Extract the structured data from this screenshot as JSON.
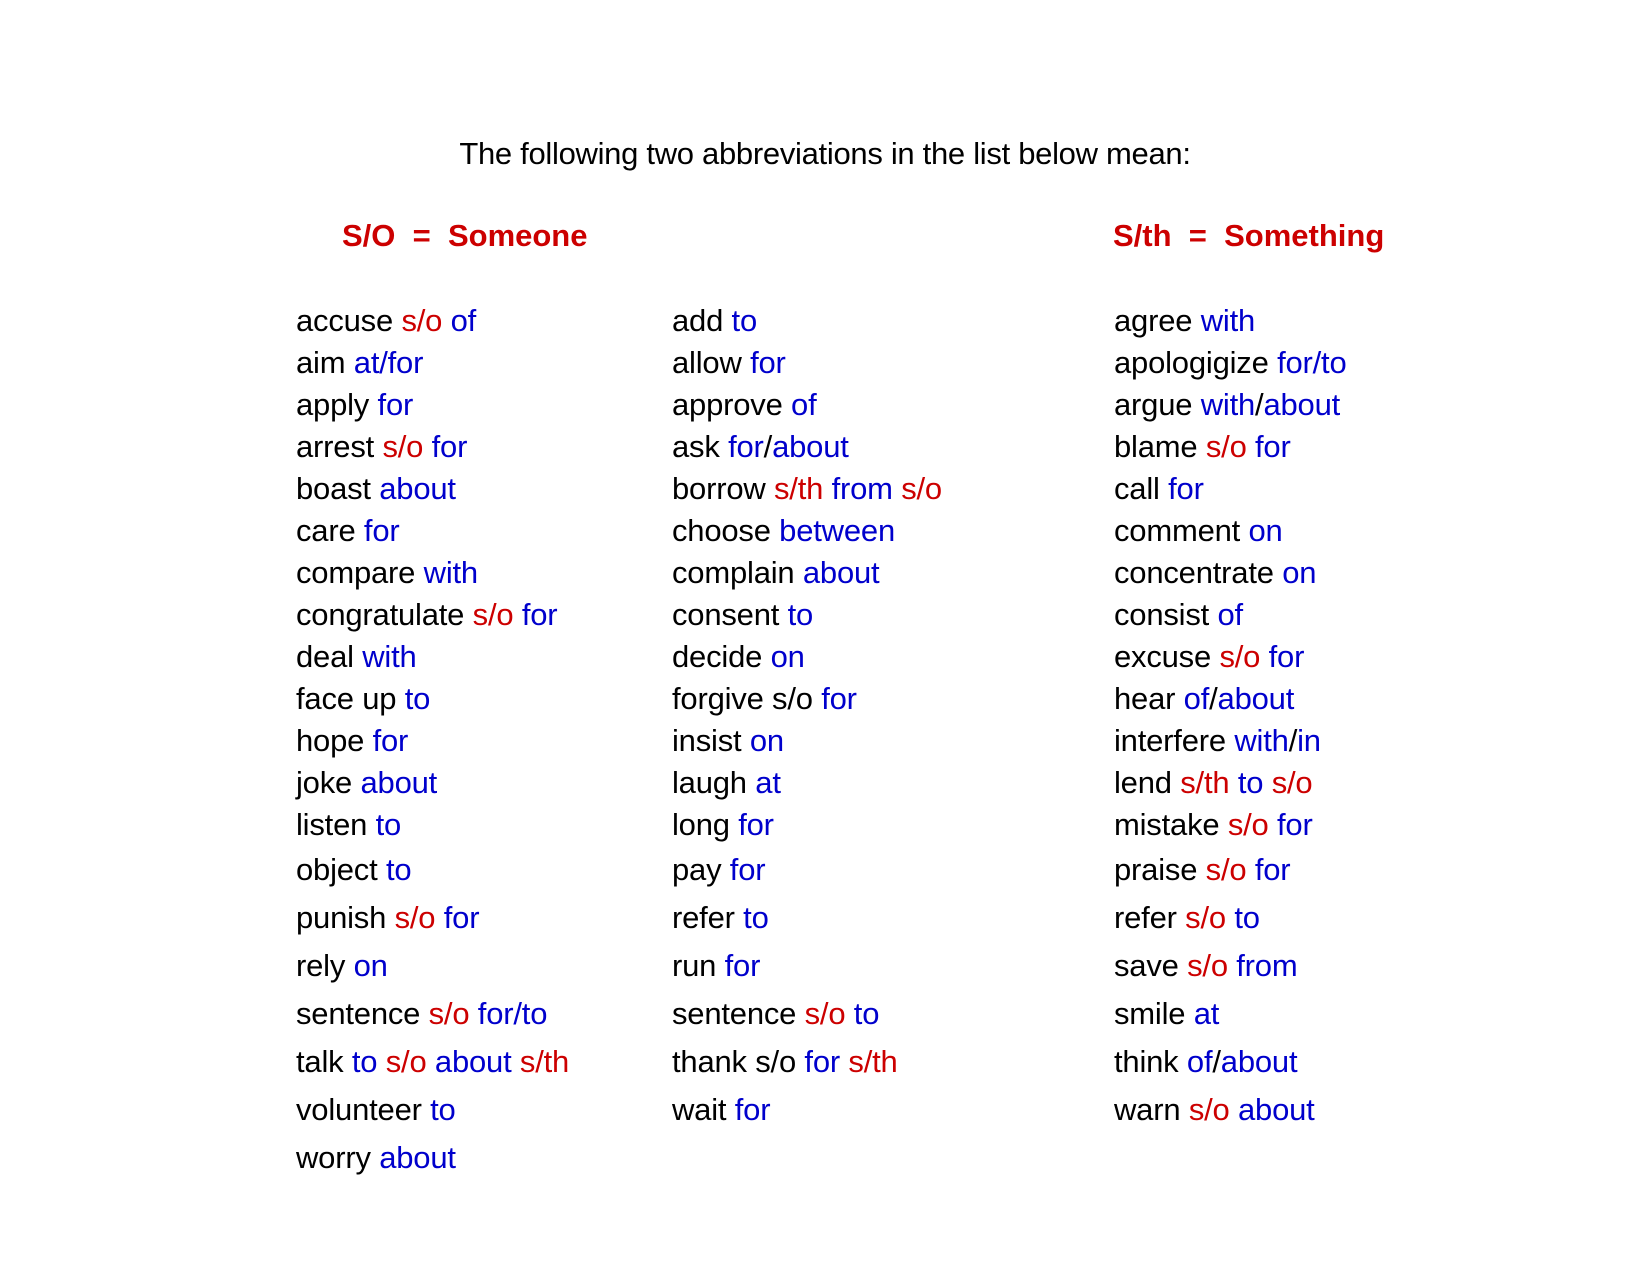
{
  "intro": "The following two abbreviations in the list below mean:",
  "legend": {
    "someone": "S/O  =  Someone",
    "something": "S/th  =  Something"
  },
  "colors": {
    "verb": "#000000",
    "placeholder": "#cc0000",
    "preposition": "#0000cc"
  },
  "columns": [
    [
      [
        [
          "accuse",
          "k"
        ],
        [
          " s/o",
          "r"
        ],
        [
          " of",
          "b"
        ]
      ],
      [
        [
          "aim",
          "k"
        ],
        [
          " at/for",
          "b"
        ]
      ],
      [
        [
          "apply",
          "k"
        ],
        [
          " for",
          "b"
        ]
      ],
      [
        [
          "arrest",
          "k"
        ],
        [
          " s/o",
          "r"
        ],
        [
          " for",
          "b"
        ]
      ],
      [
        [
          "boast",
          "k"
        ],
        [
          " about",
          "b"
        ]
      ],
      [
        [
          "care",
          "k"
        ],
        [
          " for",
          "b"
        ]
      ],
      [
        [
          "compare",
          "k"
        ],
        [
          " with",
          "b"
        ]
      ],
      [
        [
          "congratulate",
          "k"
        ],
        [
          " s/o",
          "r"
        ],
        [
          " for",
          "b"
        ]
      ],
      [
        [
          "deal",
          "k"
        ],
        [
          " with",
          "b"
        ]
      ],
      [
        [
          "face up",
          "k"
        ],
        [
          " to",
          "b"
        ]
      ],
      [
        [
          "hope",
          "k"
        ],
        [
          " for",
          "b"
        ]
      ],
      [
        [
          "joke",
          "k"
        ],
        [
          " about",
          "b"
        ]
      ],
      [
        [
          "listen",
          "k"
        ],
        [
          " to",
          "b"
        ]
      ],
      [
        [
          "object",
          "k"
        ],
        [
          " to",
          "b"
        ]
      ],
      [
        [
          "punish",
          "k"
        ],
        [
          " s/o",
          "r"
        ],
        [
          " for",
          "b"
        ]
      ],
      [
        [
          "rely",
          "k"
        ],
        [
          " on",
          "b"
        ]
      ],
      [
        [
          "sentence",
          "k"
        ],
        [
          " s/o",
          "r"
        ],
        [
          " for/to",
          "b"
        ]
      ],
      [
        [
          "talk",
          "k"
        ],
        [
          " to",
          "b"
        ],
        [
          " s/o",
          "r"
        ],
        [
          " about",
          "b"
        ],
        [
          " s/th",
          "r"
        ]
      ],
      [
        [
          "volunteer",
          "k"
        ],
        [
          " to",
          "b"
        ]
      ],
      [
        [
          "worry",
          "k"
        ],
        [
          " about",
          "b"
        ]
      ]
    ],
    [
      [
        [
          "add",
          "k"
        ],
        [
          " to",
          "b"
        ]
      ],
      [
        [
          "allow",
          "k"
        ],
        [
          " for",
          "b"
        ]
      ],
      [
        [
          "approve",
          "k"
        ],
        [
          " of",
          "b"
        ]
      ],
      [
        [
          "ask",
          "k"
        ],
        [
          " for",
          "b"
        ],
        [
          "/",
          "k"
        ],
        [
          "about",
          "b"
        ]
      ],
      [
        [
          "borrow",
          "k"
        ],
        [
          " s/th",
          "r"
        ],
        [
          " from",
          "b"
        ],
        [
          " s/o",
          "r"
        ]
      ],
      [
        [
          "choose",
          "k"
        ],
        [
          " between",
          "b"
        ]
      ],
      [
        [
          "complain",
          "k"
        ],
        [
          " about",
          "b"
        ]
      ],
      [
        [
          "consent",
          "k"
        ],
        [
          " to",
          "b"
        ]
      ],
      [
        [
          "decide",
          "k"
        ],
        [
          " on",
          "b"
        ]
      ],
      [
        [
          "forgive s/o",
          "k"
        ],
        [
          " for",
          "b"
        ]
      ],
      [
        [
          "insist",
          "k"
        ],
        [
          " on",
          "b"
        ]
      ],
      [
        [
          "laugh",
          "k"
        ],
        [
          " at",
          "b"
        ]
      ],
      [
        [
          "long",
          "k"
        ],
        [
          " for",
          "b"
        ]
      ],
      [
        [
          "pay",
          "k"
        ],
        [
          " for",
          "b"
        ]
      ],
      [
        [
          "refer",
          "k"
        ],
        [
          " to",
          "b"
        ]
      ],
      [
        [
          "run",
          "k"
        ],
        [
          " for",
          "b"
        ]
      ],
      [
        [
          "sentence",
          "k"
        ],
        [
          " s/o",
          "r"
        ],
        [
          " to",
          "b"
        ]
      ],
      [
        [
          "thank s/o",
          "k"
        ],
        [
          " for",
          "b"
        ],
        [
          " s/th",
          "r"
        ]
      ],
      [
        [
          "wait",
          "k"
        ],
        [
          " for",
          "b"
        ]
      ]
    ],
    [
      [
        [
          "agree",
          "k"
        ],
        [
          " with",
          "b"
        ]
      ],
      [
        [
          "apologigize",
          "k"
        ],
        [
          " for/to",
          "b"
        ]
      ],
      [
        [
          "argue",
          "k"
        ],
        [
          " with",
          "b"
        ],
        [
          "/",
          "k"
        ],
        [
          "about",
          "b"
        ]
      ],
      [
        [
          "blame",
          "k"
        ],
        [
          " s/o",
          "r"
        ],
        [
          " for",
          "b"
        ]
      ],
      [
        [
          "call",
          "k"
        ],
        [
          " for",
          "b"
        ]
      ],
      [
        [
          "comment",
          "k"
        ],
        [
          " on",
          "b"
        ]
      ],
      [
        [
          "concentrate",
          "k"
        ],
        [
          " on",
          "b"
        ]
      ],
      [
        [
          "consist",
          "k"
        ],
        [
          " of",
          "b"
        ]
      ],
      [
        [
          "excuse",
          "k"
        ],
        [
          " s/o",
          "r"
        ],
        [
          " for",
          "b"
        ]
      ],
      [
        [
          "hear",
          "k"
        ],
        [
          " of",
          "b"
        ],
        [
          "/",
          "k"
        ],
        [
          "about",
          "b"
        ]
      ],
      [
        [
          "interfere",
          "k"
        ],
        [
          " with",
          "b"
        ],
        [
          "/",
          "k"
        ],
        [
          "in",
          "b"
        ]
      ],
      [
        [
          "lend",
          "k"
        ],
        [
          " s/th",
          "r"
        ],
        [
          " to",
          "b"
        ],
        [
          " s/o",
          "r"
        ]
      ],
      [
        [
          "mistake",
          "k"
        ],
        [
          " s/o",
          "r"
        ],
        [
          " for",
          "b"
        ]
      ],
      [
        [
          "praise",
          "k"
        ],
        [
          " s/o",
          "r"
        ],
        [
          " for",
          "b"
        ]
      ],
      [
        [
          "refer",
          "k"
        ],
        [
          " s/o",
          "r"
        ],
        [
          " to",
          "b"
        ]
      ],
      [
        [
          "save",
          "k"
        ],
        [
          " s/o",
          "r"
        ],
        [
          " from",
          "b"
        ]
      ],
      [
        [
          "smile",
          "k"
        ],
        [
          " at",
          "b"
        ]
      ],
      [
        [
          "think",
          "k"
        ],
        [
          " of",
          "b"
        ],
        [
          "/",
          "k"
        ],
        [
          "about",
          "b"
        ]
      ],
      [
        [
          "warn",
          "k"
        ],
        [
          " s/o",
          "r"
        ],
        [
          " about",
          "b"
        ]
      ]
    ]
  ]
}
